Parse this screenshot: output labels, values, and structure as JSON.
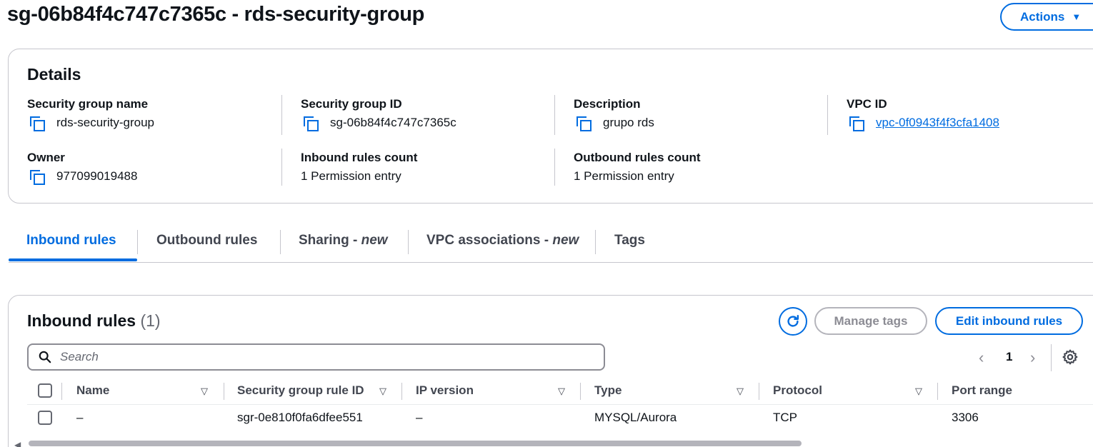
{
  "header": {
    "title": "sg-06b84f4c747c7365c - rds-security-group",
    "actions_label": "Actions"
  },
  "details": {
    "title": "Details",
    "security_group_name_label": "Security group name",
    "security_group_name": "rds-security-group",
    "security_group_id_label": "Security group ID",
    "security_group_id": "sg-06b84f4c747c7365c",
    "description_label": "Description",
    "description": "grupo rds",
    "vpc_id_label": "VPC ID",
    "vpc_id": "vpc-0f0943f4f3cfa1408",
    "owner_label": "Owner",
    "owner": "977099019488",
    "inbound_count_label": "Inbound rules count",
    "inbound_count": "1 Permission entry",
    "outbound_count_label": "Outbound rules count",
    "outbound_count": "1 Permission entry"
  },
  "tabs": {
    "inbound": "Inbound rules",
    "outbound": "Outbound rules",
    "sharing": "Sharing - ",
    "sharing_new": "new",
    "vpc_assoc": "VPC associations - ",
    "vpc_assoc_new": "new",
    "tags": "Tags"
  },
  "rules": {
    "title": "Inbound rules",
    "count": "(1)",
    "manage_tags_label": "Manage tags",
    "edit_label": "Edit inbound rules",
    "search_placeholder": "Search",
    "page": "1",
    "columns": {
      "name": "Name",
      "rule_id": "Security group rule ID",
      "ip_version": "IP version",
      "type": "Type",
      "protocol": "Protocol",
      "port_range": "Port range"
    },
    "rows": [
      {
        "name": "–",
        "rule_id": "sgr-0e810f0fa6dfee551",
        "ip_version": "–",
        "type": "MYSQL/Aurora",
        "protocol": "TCP",
        "port_range": "3306"
      }
    ]
  },
  "colors": {
    "accent": "#006ce0",
    "border": "#c6c6cd",
    "text": "#0f141a"
  }
}
